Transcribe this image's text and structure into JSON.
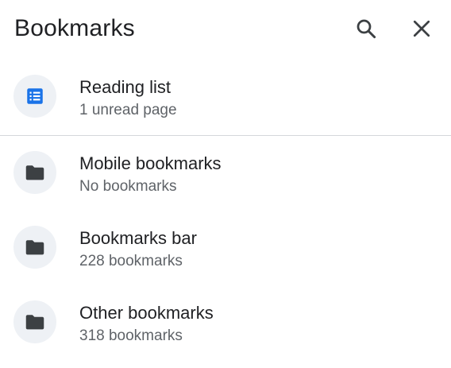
{
  "header": {
    "title": "Bookmarks",
    "search_icon": "search-icon",
    "close_icon": "close-icon"
  },
  "items": [
    {
      "title": "Reading list",
      "subtitle": "1 unread page",
      "icon": "reading-list-icon"
    },
    {
      "title": "Mobile bookmarks",
      "subtitle": "No bookmarks",
      "icon": "folder-icon"
    },
    {
      "title": "Bookmarks bar",
      "subtitle": "228 bookmarks",
      "icon": "folder-icon"
    },
    {
      "title": "Other bookmarks",
      "subtitle": "318 bookmarks",
      "icon": "folder-icon"
    }
  ],
  "colors": {
    "reading_list_accent": "#1a73e8",
    "folder": "#3c4043",
    "icon_background": "#eef1f5",
    "divider": "#d4d7db"
  }
}
